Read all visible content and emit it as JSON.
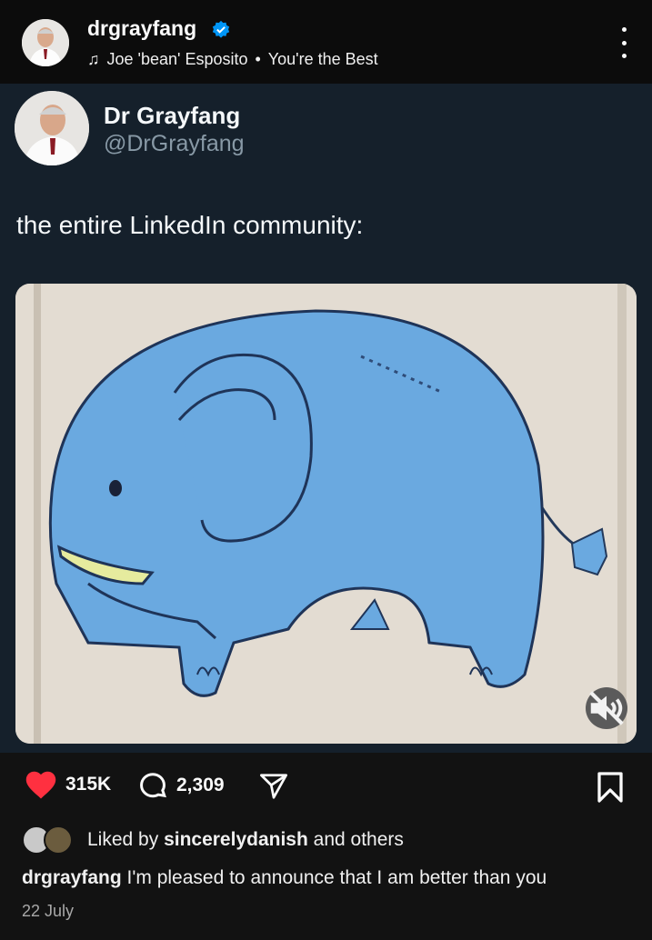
{
  "header": {
    "username": "drgrayfang",
    "music_artist": "Joe 'bean' Esposito",
    "music_separator": "•",
    "music_track": "You're the Best",
    "icons": [
      "avatar",
      "verified-badge-icon",
      "music-note-icon",
      "more-options-icon"
    ]
  },
  "tweet": {
    "display_name": "Dr Grayfang",
    "handle": "@DrGrayfang",
    "text": "the entire LinkedIn community:",
    "media": "elephant-drawing",
    "mute_icon": "volume-muted-icon"
  },
  "actions": {
    "like_count": "315K",
    "comment_count": "2,309",
    "icons": [
      "heart-icon",
      "comment-icon",
      "share-icon",
      "bookmark-icon"
    ]
  },
  "liked_by": {
    "prefix": "Liked by",
    "user": "sincerelydanish",
    "suffix": "and others"
  },
  "caption": {
    "username": "drgrayfang",
    "text": "I'm pleased to announce that I am better than you"
  },
  "date": "22 July",
  "colors": {
    "header_bg": "#0c0c0c",
    "tweet_bg": "#15202b",
    "like_red": "#ff3040",
    "verified_blue": "#0095f6",
    "elephant_blue": "#6aa9e0"
  }
}
